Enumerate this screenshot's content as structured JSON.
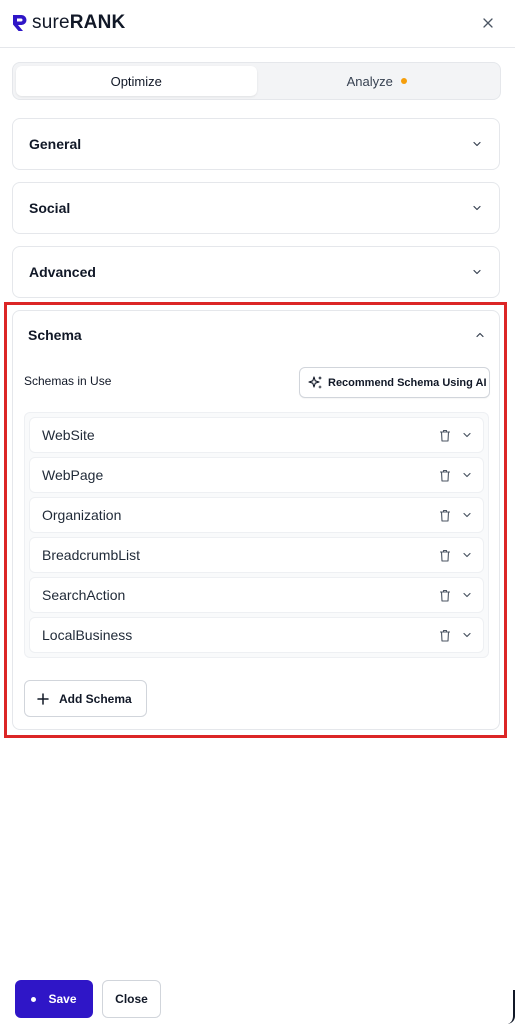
{
  "header": {
    "logo_light": "sure",
    "logo_bold": "RANK",
    "brand_color": "#2f16c7",
    "close_icon": "close-icon"
  },
  "tabs": [
    {
      "label": "Optimize",
      "active": true
    },
    {
      "label": "Analyze",
      "active": false,
      "indicator_color": "#f59e0b"
    }
  ],
  "sections": [
    {
      "title": "General",
      "expanded": false
    },
    {
      "title": "Social",
      "expanded": false
    },
    {
      "title": "Advanced",
      "expanded": false
    }
  ],
  "schema": {
    "title": "Schema",
    "expanded": true,
    "in_use_label": "Schemas in Use",
    "ai_button_label": "Recommend Schema Using AI",
    "items": [
      {
        "label": "WebSite"
      },
      {
        "label": "WebPage"
      },
      {
        "label": "Organization"
      },
      {
        "label": "BreadcrumbList"
      },
      {
        "label": "SearchAction"
      },
      {
        "label": "LocalBusiness"
      }
    ],
    "add_button_label": "Add Schema"
  },
  "footer": {
    "save_label": "Save",
    "close_label": "Close"
  },
  "highlight_color": "#dc2626"
}
